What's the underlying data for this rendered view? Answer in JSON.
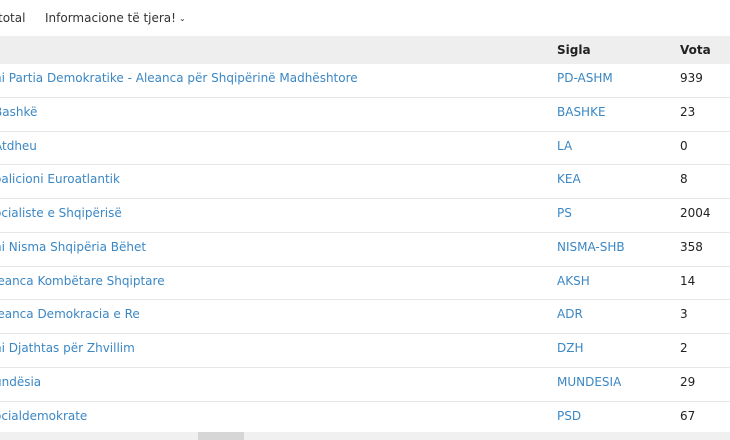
{
  "tabs": {
    "total_label": "total",
    "info_label": "Informacione të tjera!",
    "chevron": "⌄"
  },
  "table": {
    "headers": {
      "sigla": "Sigla",
      "vota": "Vota"
    },
    "rows": [
      {
        "name": "ni Partia Demokratike - Aleanca për Shqipërinë Madhështore",
        "sigla": "PD-ASHM",
        "vota": "939"
      },
      {
        "name": "Bashkë",
        "sigla": "BASHKE",
        "vota": "23"
      },
      {
        "name": "Atdheu",
        "sigla": "LA",
        "vota": "0"
      },
      {
        "name": "oalicioni Euroatlantik",
        "sigla": "KEA",
        "vota": "8"
      },
      {
        "name": "ocialiste e Shqipërisë",
        "sigla": "PS",
        "vota": "2004"
      },
      {
        "name": "ni Nisma Shqipëria Bëhet",
        "sigla": "NISMA-SHB",
        "vota": "358"
      },
      {
        "name": "leanca Kombëtare Shqiptare",
        "sigla": "AKSH",
        "vota": "14"
      },
      {
        "name": "leanca Demokracia e Re",
        "sigla": "ADR",
        "vota": "3"
      },
      {
        "name": "ni Djathtas për Zhvillim",
        "sigla": "DZH",
        "vota": "2"
      },
      {
        "name": "undësia",
        "sigla": "MUNDESIA",
        "vota": "29"
      },
      {
        "name": "ocialdemokrate",
        "sigla": "PSD",
        "vota": "67"
      }
    ]
  },
  "colors": {
    "link": "#3b87c4",
    "header_bg": "#eeeeee"
  }
}
